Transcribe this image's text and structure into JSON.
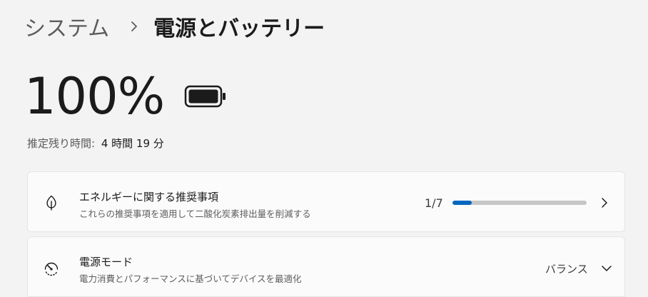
{
  "breadcrumb": {
    "parent": "システム",
    "current": "電源とバッテリー"
  },
  "battery": {
    "percent_text": "100%",
    "level": 1.0,
    "estimate_label": "推定残り時間:",
    "estimate_value": "4 時間 19 分"
  },
  "recommendations": {
    "title": "エネルギーに関する推奨事項",
    "description": "これらの推奨事項を適用して二酸化炭素排出量を削減する",
    "progress_text": "1/7",
    "progress_fraction": 0.142857,
    "icon": "leaf-icon"
  },
  "power_mode": {
    "title": "電源モード",
    "description": "電力消費とパフォーマンスに基づいてデバイスを最適化",
    "value": "バランス",
    "icon": "gauge-icon"
  },
  "colors": {
    "accent": "#0067c0",
    "background": "#f3f3f3",
    "card": "#fbfbfb"
  }
}
